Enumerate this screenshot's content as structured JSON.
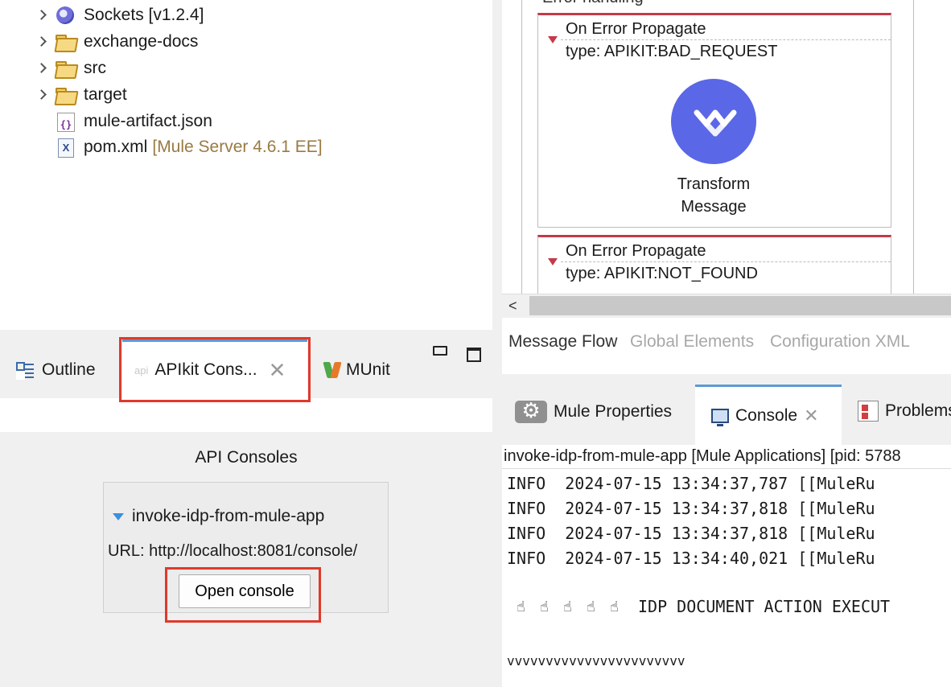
{
  "project_tree": {
    "items": [
      {
        "label": "Sockets [v1.2.4]",
        "icon": "socket-connector-icon",
        "expandable": true,
        "suffix": ""
      },
      {
        "label": "exchange-docs",
        "icon": "folder-icon",
        "expandable": true,
        "suffix": ""
      },
      {
        "label": "src",
        "icon": "folder-icon",
        "expandable": true,
        "suffix": ""
      },
      {
        "label": "target",
        "icon": "folder-icon",
        "expandable": true,
        "suffix": ""
      },
      {
        "label": "mule-artifact.json",
        "icon": "json-file-icon",
        "expandable": false,
        "suffix": ""
      },
      {
        "label": "pom.xml",
        "icon": "xml-file-icon",
        "expandable": false,
        "suffix": "[Mule Server 4.6.1 EE]"
      }
    ]
  },
  "left_tabs": {
    "outline": "Outline",
    "apikit_prefix": "api",
    "apikit": "APIkit Cons...",
    "munit": "MUnit"
  },
  "api_consoles": {
    "title": "API Consoles",
    "app_name": "invoke-idp-from-mule-app",
    "url": "URL: http://localhost:8081/console/",
    "open_button": "Open console"
  },
  "flow_canvas": {
    "error_handling_label": "Error handling",
    "handlers": [
      {
        "title": "On Error Propagate",
        "type": "type: APIKIT:BAD_REQUEST"
      },
      {
        "title": "On Error Propagate",
        "type": "type: APIKIT:NOT_FOUND"
      }
    ],
    "component_label": "Transform Message",
    "component_color": "#5a67e6"
  },
  "canvas_tabs": [
    "Message Flow",
    "Global Elements",
    "Configuration XML"
  ],
  "bottom_tabs": {
    "properties": "Mule Properties",
    "console": "Console",
    "problems": "Problems"
  },
  "console": {
    "header": "invoke-idp-from-mule-app [Mule Applications]  [pid: 5788",
    "lines": [
      "INFO  2024-07-15 13:34:37,787 [[MuleRu",
      "INFO  2024-07-15 13:34:37,818 [[MuleRu",
      "INFO  2024-07-15 13:34:37,818 [[MuleRu",
      "INFO  2024-07-15 13:34:40,021 [[MuleRu"
    ],
    "banner_text": "IDP DOCUMENT ACTION EXECUT",
    "trailer": "vvvvvvvvvvvvvvvvvvvvvvv"
  },
  "highlight_color": "#e0392b"
}
